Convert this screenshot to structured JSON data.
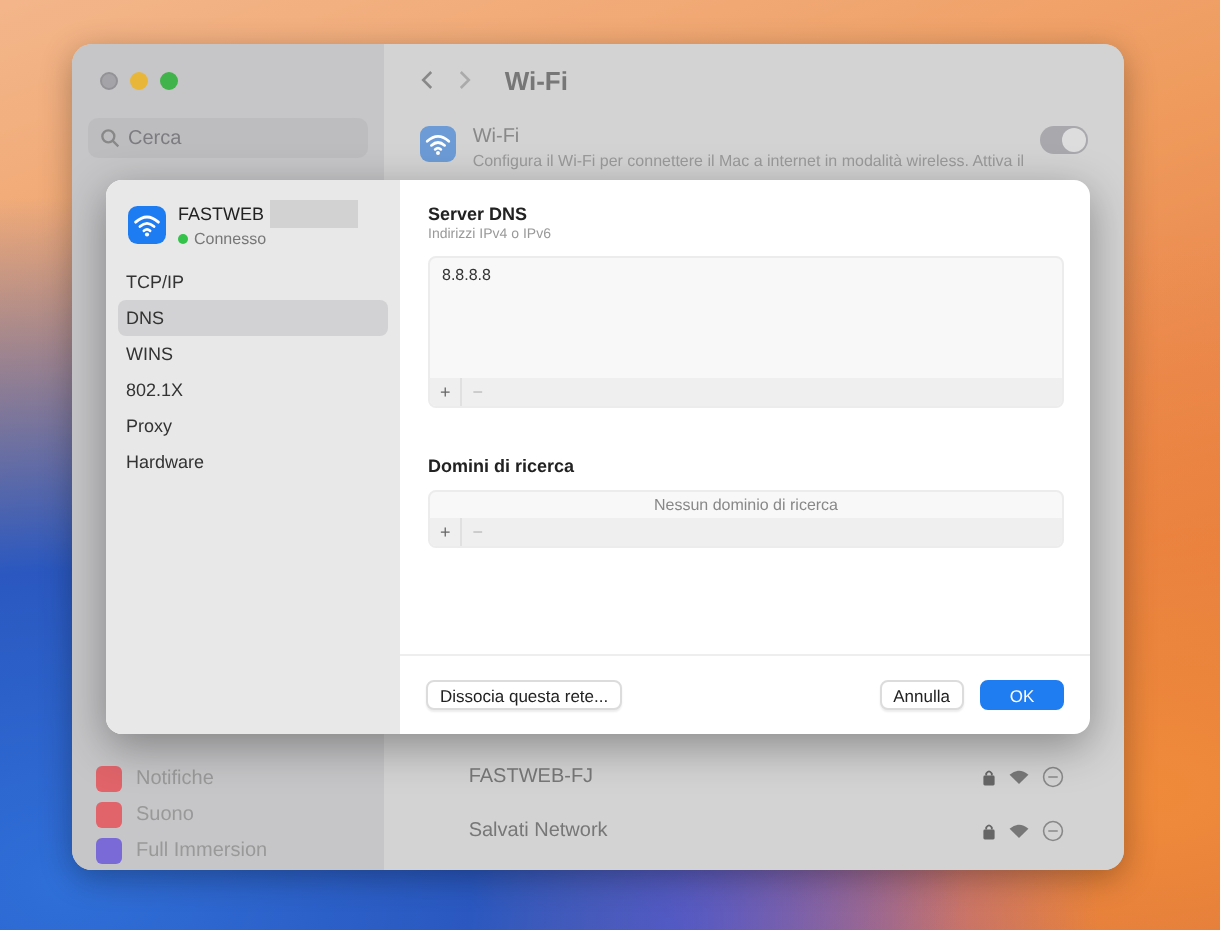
{
  "window": {
    "title": "Wi-Fi",
    "search": {
      "placeholder": "Cerca"
    },
    "sidebar": {
      "items": [
        {
          "label": "Notifiche",
          "color": "#e0646a"
        },
        {
          "label": "Suono",
          "color": "#e0646a"
        },
        {
          "label": "Full Immersion",
          "color": "#7a6ad8"
        }
      ]
    },
    "wifi": {
      "title": "Wi-Fi",
      "description": "Configura il Wi-Fi per connettere il Mac a internet in modalità wireless. Attiva il",
      "on": true
    },
    "networks": [
      {
        "name": "FASTWEB-FJ"
      },
      {
        "name": "Salvati Network"
      }
    ]
  },
  "sheet": {
    "network": {
      "name": "FASTWEB",
      "status": "Connesso"
    },
    "tabs": [
      {
        "label": "TCP/IP",
        "selected": false
      },
      {
        "label": "DNS",
        "selected": true
      },
      {
        "label": "WINS",
        "selected": false
      },
      {
        "label": "802.1X",
        "selected": false
      },
      {
        "label": "Proxy",
        "selected": false
      },
      {
        "label": "Hardware",
        "selected": false
      }
    ],
    "dns": {
      "title": "Server DNS",
      "subtitle": "Indirizzi IPv4 o IPv6",
      "servers": [
        "8.8.8.8"
      ],
      "add": "+",
      "remove": "−"
    },
    "search_domains": {
      "title": "Domini di ricerca",
      "empty_text": "Nessun dominio di ricerca",
      "add": "+",
      "remove": "−"
    },
    "buttons": [
      {
        "label": "Dissocia questa rete...",
        "kind": "secondary"
      },
      {
        "label": "Annulla",
        "kind": "secondary"
      },
      {
        "label": "OK",
        "kind": "primary"
      }
    ]
  }
}
